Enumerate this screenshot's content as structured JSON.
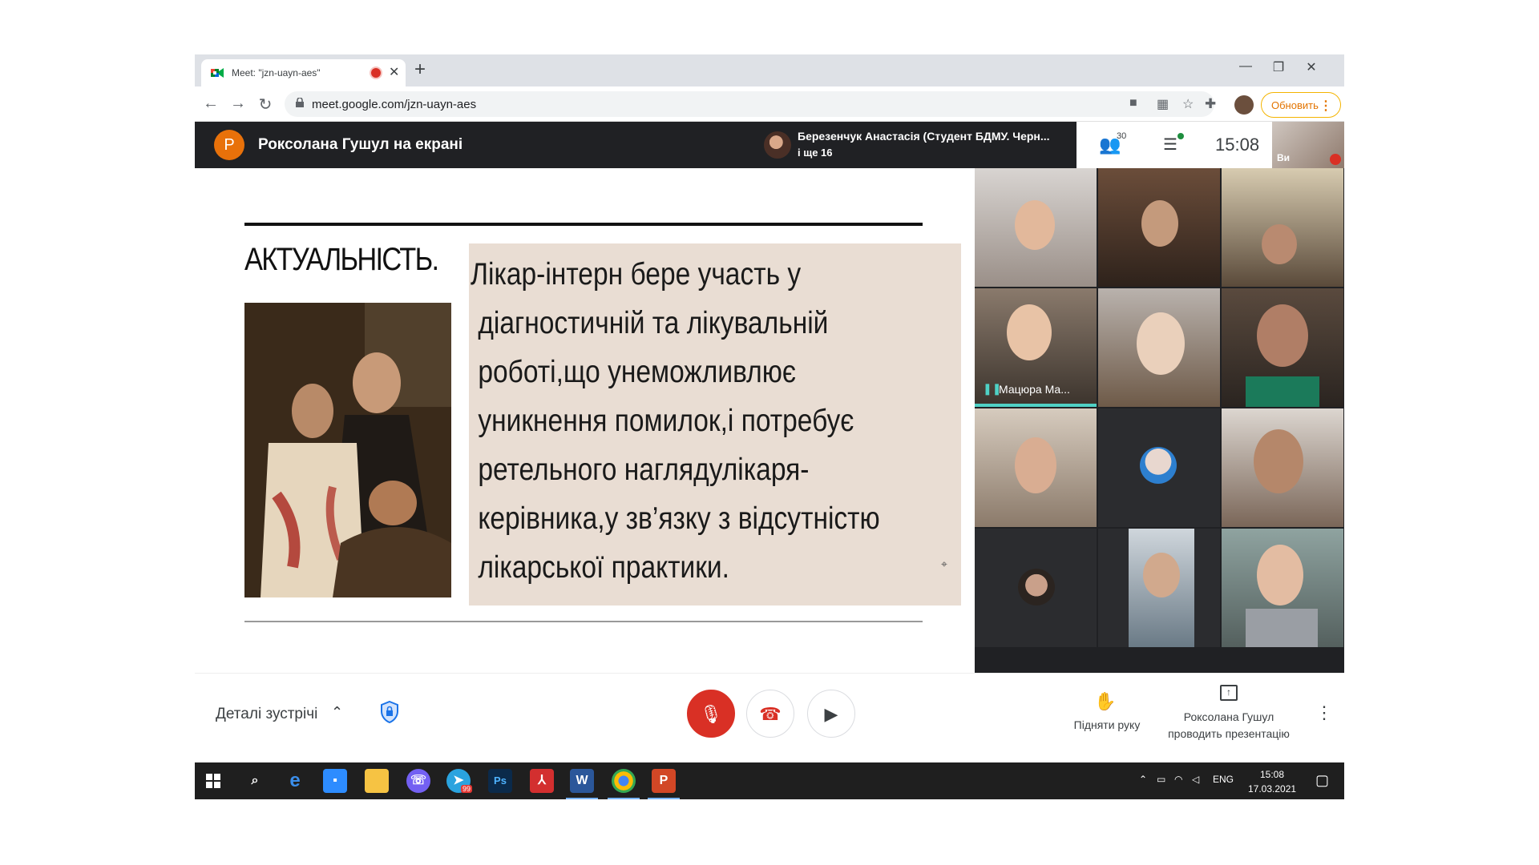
{
  "browser": {
    "tab_title": "Meet: \"jzn-uayn-aes\"",
    "tab_close": "✕",
    "new_tab": "+",
    "url": "meet.google.com/jzn-uayn-aes",
    "update_button": "Обновить",
    "window_controls": [
      "—",
      "❐",
      "✕"
    ],
    "nav": [
      "←",
      "→",
      "↻"
    ]
  },
  "meet": {
    "presenter_initial": "Р",
    "presenter_title": "Роксолана Гушул на екрані",
    "active_speaker": "Березенчук Анастасія (Студент БДМУ. Черн...",
    "others_count": "і ще 16",
    "people_count": "30",
    "time": "15:08",
    "self_label": "Ви"
  },
  "slide": {
    "heading": "АКТУАЛЬНІСТЬ.",
    "body_lines": [
      "Лікар-інтерн бере участь у",
      " діагностичній та лікувальній",
      " роботі,що унеможливлює",
      " уникнення помилок,і потребує",
      " ретельного наглядулікаря-",
      " керівника,у зв’язку з відсутністю",
      " лікарської практики."
    ]
  },
  "grid": {
    "highlighted_name": "Мацюра Ма..."
  },
  "bottom": {
    "meeting_details": "Деталі зустрічі",
    "raise_hand": "Підняти руку",
    "presenting_line1": "Роксолана Гушул",
    "presenting_line2": "проводить презентацію"
  },
  "taskbar": {
    "lang": "ENG",
    "time": "15:08",
    "date": "17.03.2021",
    "telegram_badge": "99"
  },
  "colors": {
    "accent_red": "#d93025",
    "presenter_orange": "#e8710a",
    "slide_box": "#e9ddd3",
    "meet_dark": "#202124"
  }
}
